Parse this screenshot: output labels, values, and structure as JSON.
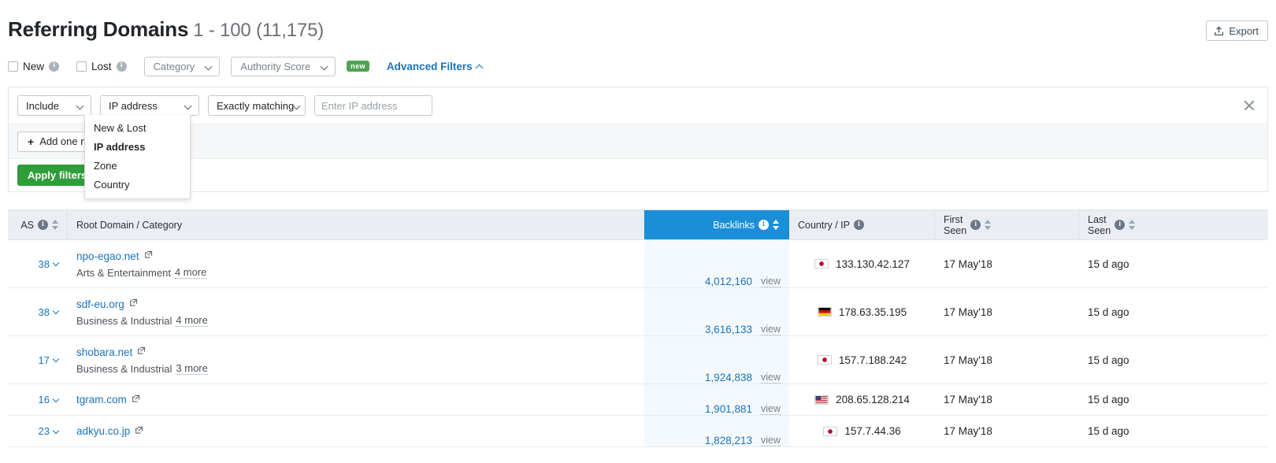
{
  "header": {
    "title": "Referring Domains",
    "range": "1 - 100 (11,175)",
    "export_label": "Export",
    "export_icon": "upload-icon"
  },
  "filterbar": {
    "new_label": "New",
    "lost_label": "Lost",
    "category_label": "Category",
    "authority_score_label": "Authority Score",
    "new_badge": "new",
    "advanced_filters_label": "Advanced Filters",
    "info_icon": "info-icon",
    "chevron_down_icon": "chevron-down-icon",
    "chevron_up_icon": "chevron-up-icon"
  },
  "advanced_panel": {
    "include_value": "Include",
    "field_value": "IP address",
    "match_value": "Exactly matching",
    "value_input": "",
    "value_placeholder": "Enter IP address",
    "add_more_label": "Add one more",
    "apply_label": "Apply filters",
    "close_icon": "close-icon",
    "plus_icon": "plus-icon"
  },
  "dropdown": {
    "open": true,
    "selected": "IP address",
    "options": [
      "New & Lost",
      "IP address",
      "Zone",
      "Country"
    ]
  },
  "table": {
    "columns": [
      {
        "key": "as",
        "label": "AS",
        "info": true,
        "sortable": true,
        "highlight": false
      },
      {
        "key": "dom",
        "label": "Root Domain / Category",
        "info": false,
        "sortable": false,
        "highlight": false
      },
      {
        "key": "back",
        "label": "Backlinks",
        "info": true,
        "sortable": true,
        "highlight": true
      },
      {
        "key": "ip",
        "label": "Country / IP",
        "info": true,
        "sortable": false,
        "highlight": false
      },
      {
        "key": "first",
        "label": "First\nSeen",
        "info": true,
        "sortable": true,
        "highlight": false
      },
      {
        "key": "last",
        "label": "Last\nSeen",
        "info": true,
        "sortable": true,
        "highlight": false
      }
    ],
    "view_label": "view",
    "rows": [
      {
        "as": "38",
        "domain": "npo-egao.net",
        "category": "Arts & Entertainment",
        "more": "4 more",
        "backlinks": "4,012,160",
        "country": "jp",
        "ip": "133.130.42.127",
        "first_seen": "17 May'18",
        "last_seen": "15 d ago"
      },
      {
        "as": "38",
        "domain": "sdf-eu.org",
        "category": "Business & Industrial",
        "more": "4 more",
        "backlinks": "3,616,133",
        "country": "de",
        "ip": "178.63.35.195",
        "first_seen": "17 May'18",
        "last_seen": "15 d ago"
      },
      {
        "as": "17",
        "domain": "shobara.net",
        "category": "Business & Industrial",
        "more": "3 more",
        "backlinks": "1,924,838",
        "country": "jp",
        "ip": "157.7.188.242",
        "first_seen": "17 May'18",
        "last_seen": "15 d ago"
      },
      {
        "as": "16",
        "domain": "tgram.com",
        "category": "",
        "more": "",
        "backlinks": "1,901,881",
        "country": "us",
        "ip": "208.65.128.214",
        "first_seen": "17 May'18",
        "last_seen": "15 d ago"
      },
      {
        "as": "23",
        "domain": "adkyu.co.jp",
        "category": "",
        "more": "",
        "backlinks": "1,828,213",
        "country": "jp",
        "ip": "157.7.44.36",
        "first_seen": "17 May'18",
        "last_seen": "15 d ago"
      }
    ]
  },
  "colors": {
    "link": "#1a74bb",
    "accent_blue": "#1a8fd8",
    "apply_green": "#2e9e38",
    "badge_green": "#51a351",
    "header_bg": "#eaeef2"
  }
}
